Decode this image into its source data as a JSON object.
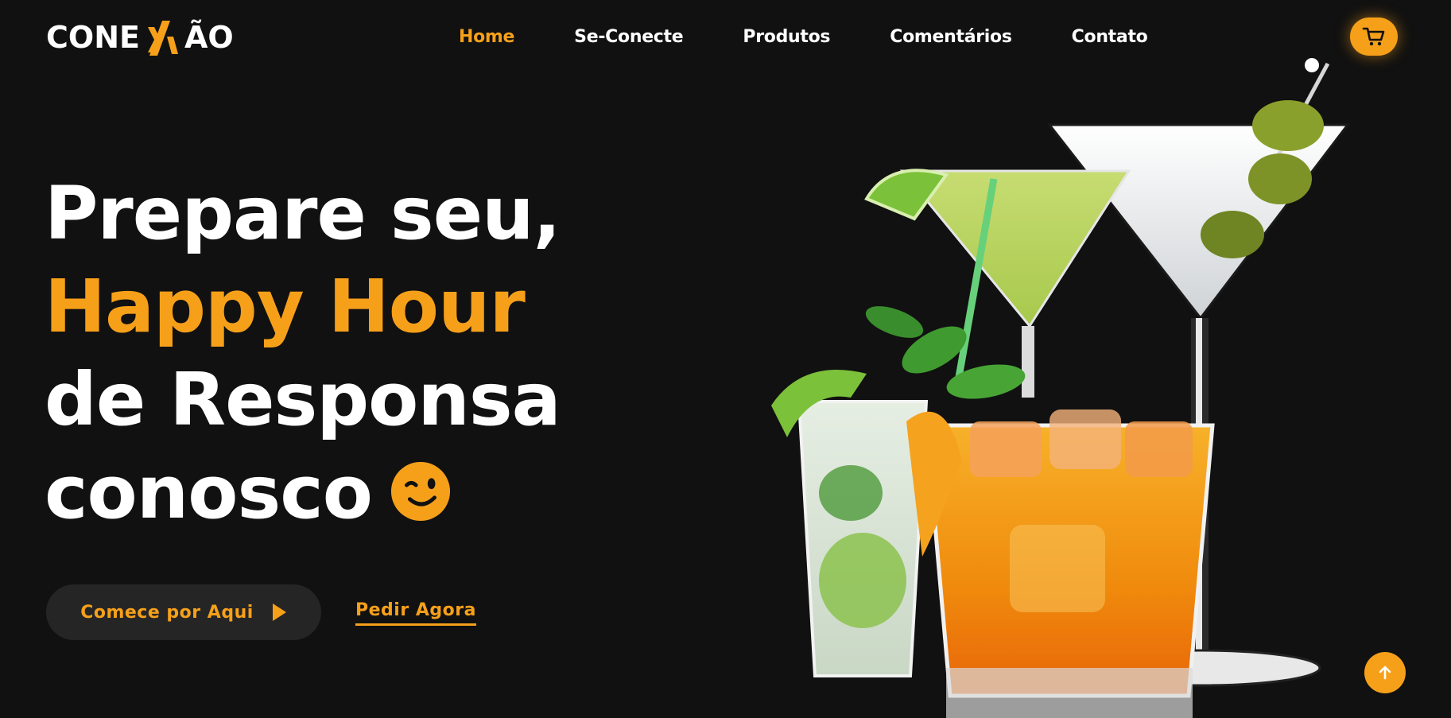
{
  "header": {
    "logo": {
      "left_text": "CONE",
      "right_text": "ÃO"
    },
    "nav": [
      {
        "label": "Home",
        "active": true
      },
      {
        "label": "Se-Conecte",
        "active": false
      },
      {
        "label": "Produtos",
        "active": false
      },
      {
        "label": "Comentários",
        "active": false
      },
      {
        "label": "Contato",
        "active": false
      }
    ],
    "cart_icon": "shopping-cart-icon"
  },
  "hero": {
    "line1": "Prepare seu,",
    "line2": "Happy Hour",
    "line3": "de Responsa",
    "line4": "conosco",
    "emoji_icon": "winking-face-icon"
  },
  "actions": {
    "primary_label": "Comece por Aqui",
    "primary_icon": "play-arrow-icon",
    "secondary_label": "Pedir Agora"
  },
  "back_to_top_icon": "arrow-up-icon",
  "colors": {
    "background": "#111111",
    "accent": "#f6a01a",
    "text": "#ffffff",
    "button_bg": "#252525"
  }
}
